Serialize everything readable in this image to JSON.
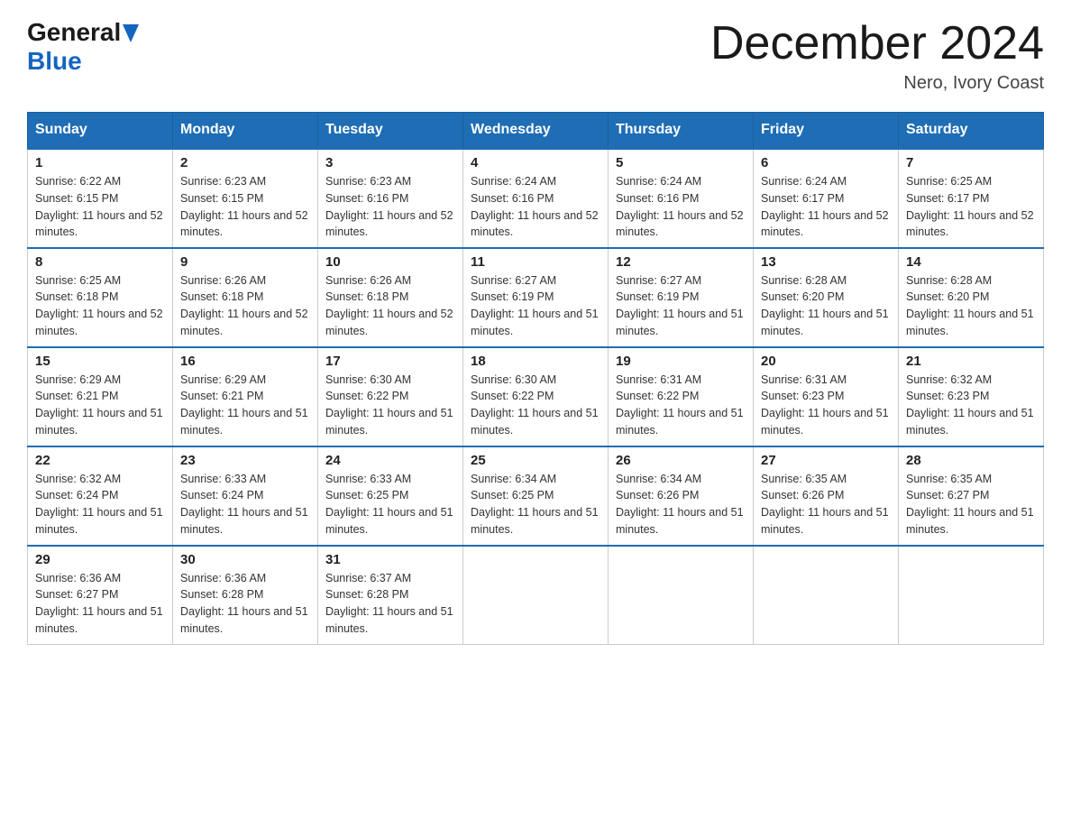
{
  "logo": {
    "general": "General",
    "blue": "Blue",
    "arrow_color": "#1565c0"
  },
  "title": {
    "month_year": "December 2024",
    "location": "Nero, Ivory Coast"
  },
  "days_of_week": [
    "Sunday",
    "Monday",
    "Tuesday",
    "Wednesday",
    "Thursday",
    "Friday",
    "Saturday"
  ],
  "weeks": [
    [
      {
        "day": "1",
        "sunrise": "6:22 AM",
        "sunset": "6:15 PM",
        "daylight": "11 hours and 52 minutes."
      },
      {
        "day": "2",
        "sunrise": "6:23 AM",
        "sunset": "6:15 PM",
        "daylight": "11 hours and 52 minutes."
      },
      {
        "day": "3",
        "sunrise": "6:23 AM",
        "sunset": "6:16 PM",
        "daylight": "11 hours and 52 minutes."
      },
      {
        "day": "4",
        "sunrise": "6:24 AM",
        "sunset": "6:16 PM",
        "daylight": "11 hours and 52 minutes."
      },
      {
        "day": "5",
        "sunrise": "6:24 AM",
        "sunset": "6:16 PM",
        "daylight": "11 hours and 52 minutes."
      },
      {
        "day": "6",
        "sunrise": "6:24 AM",
        "sunset": "6:17 PM",
        "daylight": "11 hours and 52 minutes."
      },
      {
        "day": "7",
        "sunrise": "6:25 AM",
        "sunset": "6:17 PM",
        "daylight": "11 hours and 52 minutes."
      }
    ],
    [
      {
        "day": "8",
        "sunrise": "6:25 AM",
        "sunset": "6:18 PM",
        "daylight": "11 hours and 52 minutes."
      },
      {
        "day": "9",
        "sunrise": "6:26 AM",
        "sunset": "6:18 PM",
        "daylight": "11 hours and 52 minutes."
      },
      {
        "day": "10",
        "sunrise": "6:26 AM",
        "sunset": "6:18 PM",
        "daylight": "11 hours and 52 minutes."
      },
      {
        "day": "11",
        "sunrise": "6:27 AM",
        "sunset": "6:19 PM",
        "daylight": "11 hours and 51 minutes."
      },
      {
        "day": "12",
        "sunrise": "6:27 AM",
        "sunset": "6:19 PM",
        "daylight": "11 hours and 51 minutes."
      },
      {
        "day": "13",
        "sunrise": "6:28 AM",
        "sunset": "6:20 PM",
        "daylight": "11 hours and 51 minutes."
      },
      {
        "day": "14",
        "sunrise": "6:28 AM",
        "sunset": "6:20 PM",
        "daylight": "11 hours and 51 minutes."
      }
    ],
    [
      {
        "day": "15",
        "sunrise": "6:29 AM",
        "sunset": "6:21 PM",
        "daylight": "11 hours and 51 minutes."
      },
      {
        "day": "16",
        "sunrise": "6:29 AM",
        "sunset": "6:21 PM",
        "daylight": "11 hours and 51 minutes."
      },
      {
        "day": "17",
        "sunrise": "6:30 AM",
        "sunset": "6:22 PM",
        "daylight": "11 hours and 51 minutes."
      },
      {
        "day": "18",
        "sunrise": "6:30 AM",
        "sunset": "6:22 PM",
        "daylight": "11 hours and 51 minutes."
      },
      {
        "day": "19",
        "sunrise": "6:31 AM",
        "sunset": "6:22 PM",
        "daylight": "11 hours and 51 minutes."
      },
      {
        "day": "20",
        "sunrise": "6:31 AM",
        "sunset": "6:23 PM",
        "daylight": "11 hours and 51 minutes."
      },
      {
        "day": "21",
        "sunrise": "6:32 AM",
        "sunset": "6:23 PM",
        "daylight": "11 hours and 51 minutes."
      }
    ],
    [
      {
        "day": "22",
        "sunrise": "6:32 AM",
        "sunset": "6:24 PM",
        "daylight": "11 hours and 51 minutes."
      },
      {
        "day": "23",
        "sunrise": "6:33 AM",
        "sunset": "6:24 PM",
        "daylight": "11 hours and 51 minutes."
      },
      {
        "day": "24",
        "sunrise": "6:33 AM",
        "sunset": "6:25 PM",
        "daylight": "11 hours and 51 minutes."
      },
      {
        "day": "25",
        "sunrise": "6:34 AM",
        "sunset": "6:25 PM",
        "daylight": "11 hours and 51 minutes."
      },
      {
        "day": "26",
        "sunrise": "6:34 AM",
        "sunset": "6:26 PM",
        "daylight": "11 hours and 51 minutes."
      },
      {
        "day": "27",
        "sunrise": "6:35 AM",
        "sunset": "6:26 PM",
        "daylight": "11 hours and 51 minutes."
      },
      {
        "day": "28",
        "sunrise": "6:35 AM",
        "sunset": "6:27 PM",
        "daylight": "11 hours and 51 minutes."
      }
    ],
    [
      {
        "day": "29",
        "sunrise": "6:36 AM",
        "sunset": "6:27 PM",
        "daylight": "11 hours and 51 minutes."
      },
      {
        "day": "30",
        "sunrise": "6:36 AM",
        "sunset": "6:28 PM",
        "daylight": "11 hours and 51 minutes."
      },
      {
        "day": "31",
        "sunrise": "6:37 AM",
        "sunset": "6:28 PM",
        "daylight": "11 hours and 51 minutes."
      },
      null,
      null,
      null,
      null
    ]
  ]
}
